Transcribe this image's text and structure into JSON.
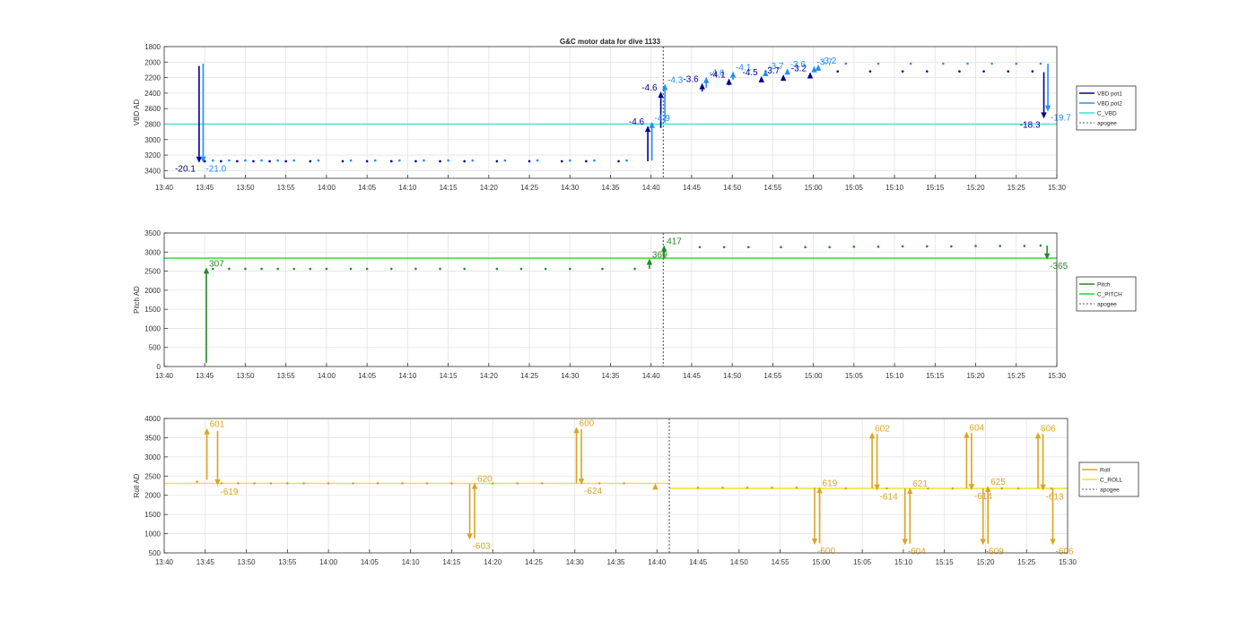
{
  "figure": {
    "title": "G&C motor data for dive 1133"
  },
  "chart_data": [
    {
      "type": "scatter",
      "ylabel": "VBD AD",
      "xlim": [
        "13:40",
        "15:30"
      ],
      "ylim": [
        1800,
        3500
      ],
      "y_reversed": true,
      "grid": true,
      "legend_placement": "right",
      "xticks": [
        "13:40",
        "13:45",
        "13:50",
        "13:55",
        "14:00",
        "14:05",
        "14:10",
        "14:15",
        "14:20",
        "14:25",
        "14:30",
        "14:35",
        "14:40",
        "14:45",
        "14:50",
        "14:55",
        "15:00",
        "15:05",
        "15:10",
        "15:15",
        "15:20",
        "15:25",
        "15:30"
      ],
      "yticks": [
        1800,
        2000,
        2200,
        2400,
        2600,
        2800,
        3000,
        3200,
        3400
      ],
      "legend": [
        {
          "name": "VBD pot1",
          "color": "#00008b"
        },
        {
          "name": "VBD pot2",
          "color": "#1e90ff"
        },
        {
          "name": "C_VBD",
          "color": "#40e0d0"
        },
        {
          "name": "apogee",
          "color": "#555555"
        }
      ],
      "apogee_x": "14:41.5",
      "reference": {
        "name": "C_VBD",
        "y": 2800,
        "color": "#40e0d0"
      },
      "series": [
        {
          "name": "VBD pot1",
          "color": "#00008b",
          "x": [
            "13:45",
            "13:47",
            "13:49",
            "13:51",
            "13:53",
            "13:55",
            "13:58",
            "14:02",
            "14:05",
            "14:08",
            "14:11",
            "14:14",
            "14:17",
            "14:21",
            "14:25",
            "14:29",
            "14:32",
            "14:36",
            "15:03",
            "15:07",
            "15:11",
            "15:14",
            "15:18",
            "15:21",
            "15:24",
            "15:27"
          ],
          "y": [
            3280,
            3280,
            3280,
            3280,
            3280,
            3280,
            3280,
            3280,
            3280,
            3280,
            3280,
            3280,
            3280,
            3280,
            3280,
            3280,
            3280,
            3280,
            2120,
            2120,
            2120,
            2120,
            2120,
            2120,
            2120,
            2120
          ]
        },
        {
          "name": "VBD pot2",
          "color": "#1e90ff",
          "x": [
            "13:46",
            "13:48",
            "13:50",
            "13:52",
            "13:54",
            "13:56",
            "13:59",
            "14:03",
            "14:06",
            "14:09",
            "14:12",
            "14:15",
            "14:18",
            "14:22",
            "14:26",
            "14:30",
            "14:33",
            "14:37",
            "15:04",
            "15:08",
            "15:12",
            "15:16",
            "15:19",
            "15:22",
            "15:25",
            "15:28"
          ],
          "y": [
            3270,
            3270,
            3270,
            3270,
            3270,
            3270,
            3270,
            3270,
            3270,
            3270,
            3270,
            3270,
            3270,
            3270,
            3270,
            3270,
            3270,
            3270,
            2020,
            2020,
            2020,
            2020,
            2020,
            2020,
            2020,
            2020
          ]
        }
      ],
      "arrows": [
        {
          "x": "13:44.3",
          "y0": 2050,
          "y1": 3300,
          "color": "#00008b",
          "label": "-20.1",
          "label_side": "left"
        },
        {
          "x": "13:44.8",
          "y0": 2020,
          "y1": 3300,
          "color": "#1e90ff",
          "label": "-21.0",
          "label_side": "right"
        },
        {
          "x": "14:39.6",
          "y0": 3280,
          "y1": 2820,
          "color": "#00008b",
          "label": "-4.6",
          "label_side": "left"
        },
        {
          "x": "14:40.1",
          "y0": 3270,
          "y1": 2770,
          "color": "#1e90ff",
          "label": "-4.9",
          "label_side": "right"
        },
        {
          "x": "14:41.2",
          "y0": 2850,
          "y1": 2380,
          "color": "#00008b",
          "label": "-4.6",
          "label_side": "left"
        },
        {
          "x": "14:41.7",
          "y0": 2780,
          "y1": 2280,
          "color": "#1e90ff",
          "label": "-4.3",
          "label_side": "right"
        },
        {
          "x": "14:46.3",
          "y0": 2380,
          "y1": 2270,
          "color": "#00008b",
          "label": "-3.6",
          "label_side": "left"
        },
        {
          "x": "14:46.8",
          "y0": 2330,
          "y1": 2190,
          "color": "#1e90ff",
          "label": "-4.6",
          "label_side": "right"
        },
        {
          "x": "14:49.6",
          "y0": 2300,
          "y1": 2210,
          "color": "#00008b",
          "label": "-4.1",
          "label_side": "left"
        },
        {
          "x": "14:50.1",
          "y0": 2230,
          "y1": 2120,
          "color": "#1e90ff",
          "label": "-4.1",
          "label_side": "right"
        },
        {
          "x": "14:53.6",
          "y0": 2250,
          "y1": 2180,
          "color": "#00008b",
          "label": "-4.5",
          "label_side": "left"
        },
        {
          "x": "14:54.1",
          "y0": 2180,
          "y1": 2100,
          "color": "#1e90ff",
          "label": "-3.7",
          "label_side": "right"
        },
        {
          "x": "14:56.3",
          "y0": 2220,
          "y1": 2160,
          "color": "#00008b",
          "label": "-3.7",
          "label_side": "left"
        },
        {
          "x": "14:56.8",
          "y0": 2130,
          "y1": 2080,
          "color": "#1e90ff",
          "label": "-3.6",
          "label_side": "right"
        },
        {
          "x": "14:59.6",
          "y0": 2180,
          "y1": 2130,
          "color": "#00008b",
          "label": "-3.2",
          "label_side": "left"
        },
        {
          "x": "15:00.1",
          "y0": 2110,
          "y1": 2050,
          "color": "#1e90ff",
          "label": "-3.7",
          "label_side": "right"
        },
        {
          "x": "15:00.6",
          "y0": 2110,
          "y1": 2030,
          "color": "#1e90ff",
          "label": "-3.2",
          "label_side": "right"
        },
        {
          "x": "15:28.4",
          "y0": 2130,
          "y1": 2730,
          "color": "#00008b",
          "label": "-18.3",
          "label_side": "left"
        },
        {
          "x": "15:28.9",
          "y0": 2020,
          "y1": 2640,
          "color": "#1e90ff",
          "label": "-19.7",
          "label_side": "right"
        }
      ]
    },
    {
      "type": "scatter",
      "ylabel": "Pitch AD",
      "xlim": [
        "13:40",
        "15:30"
      ],
      "ylim": [
        0,
        3500
      ],
      "grid": true,
      "legend_placement": "right",
      "xticks": [
        "13:40",
        "13:45",
        "13:50",
        "13:55",
        "14:00",
        "14:05",
        "14:10",
        "14:15",
        "14:20",
        "14:25",
        "14:30",
        "14:35",
        "14:40",
        "14:45",
        "14:50",
        "14:55",
        "15:00",
        "15:05",
        "15:10",
        "15:15",
        "15:20",
        "15:25",
        "15:30"
      ],
      "yticks": [
        0,
        500,
        1000,
        1500,
        2000,
        2500,
        3000,
        3500
      ],
      "legend": [
        {
          "name": "Pitch",
          "color": "#228b22"
        },
        {
          "name": "C_PITCH",
          "color": "#32cd32"
        },
        {
          "name": "apogee",
          "color": "#555555"
        }
      ],
      "apogee_x": "14:41.5",
      "reference": {
        "name": "C_PITCH",
        "y": 2840,
        "color": "#32cd32"
      },
      "series": [
        {
          "name": "Pitch",
          "color": "#228b22",
          "x": [
            "13:46",
            "13:48",
            "13:50",
            "13:52",
            "13:54",
            "13:56",
            "13:58",
            "14:00",
            "14:03",
            "14:05",
            "14:08",
            "14:11",
            "14:14",
            "14:17",
            "14:21",
            "14:24",
            "14:27",
            "14:30",
            "14:34",
            "14:38",
            "14:46",
            "14:49",
            "14:52",
            "14:56",
            "14:59",
            "15:02",
            "15:05",
            "15:08",
            "15:11",
            "15:14",
            "15:17",
            "15:20",
            "15:23",
            "15:26",
            "15:28"
          ],
          "y": [
            2560,
            2560,
            2560,
            2560,
            2560,
            2560,
            2560,
            2560,
            2560,
            2560,
            2560,
            2560,
            2560,
            2560,
            2560,
            2560,
            2560,
            2560,
            2560,
            2560,
            3130,
            3130,
            3130,
            3130,
            3130,
            3130,
            3140,
            3140,
            3150,
            3150,
            3150,
            3160,
            3160,
            3160,
            3170
          ]
        }
      ],
      "arrows": [
        {
          "x": "13:45.2",
          "y0": 100,
          "y1": 2600,
          "color": "#228b22",
          "label": "307",
          "label_side": "right"
        },
        {
          "x": "14:39.8",
          "y0": 2560,
          "y1": 2830,
          "color": "#228b22",
          "label": "369",
          "label_side": "right"
        },
        {
          "x": "14:41.6",
          "y0": 2840,
          "y1": 3180,
          "color": "#228b22",
          "label": "417",
          "label_side": "right"
        },
        {
          "x": "15:28.8",
          "y0": 3170,
          "y1": 2800,
          "color": "#228b22",
          "label": "-365",
          "label_side": "right"
        }
      ]
    },
    {
      "type": "scatter",
      "ylabel": "Roll AD",
      "xlim": [
        "13:40",
        "15:30"
      ],
      "ylim": [
        500,
        4000
      ],
      "grid": true,
      "legend_placement": "right",
      "xticks": [
        "13:40",
        "13:45",
        "13:50",
        "13:55",
        "14:00",
        "14:05",
        "14:10",
        "14:15",
        "14:20",
        "14:25",
        "14:30",
        "14:35",
        "14:40",
        "14:45",
        "14:50",
        "14:55",
        "15:00",
        "15:05",
        "15:10",
        "15:15",
        "15:20",
        "15:25",
        "15:30"
      ],
      "yticks": [
        500,
        1000,
        1500,
        2000,
        2500,
        3000,
        3500,
        4000
      ],
      "legend": [
        {
          "name": "Roll",
          "color": "#daa520"
        },
        {
          "name": "C_ROLL",
          "color": "#f0e130"
        },
        {
          "name": "apogee",
          "color": "#555555"
        }
      ],
      "apogee_x": "14:41.5",
      "reference_segments": [
        {
          "x0": "13:40",
          "x1": "14:41.5",
          "y": 2310,
          "color": "#f0e130"
        },
        {
          "x0": "14:41.5",
          "x1": "15:30",
          "y": 2180,
          "color": "#f0e130"
        }
      ],
      "series": [
        {
          "name": "Roll",
          "color": "#daa520",
          "x": [
            "13:44",
            "13:47",
            "13:49",
            "13:51",
            "13:53",
            "13:55",
            "13:57",
            "14:00",
            "14:03",
            "14:06",
            "14:09",
            "14:12",
            "14:15",
            "14:20",
            "14:23",
            "14:26",
            "14:33",
            "14:36",
            "14:45",
            "14:48",
            "14:51",
            "14:54",
            "14:57",
            "15:03",
            "15:08",
            "15:13",
            "15:16",
            "15:22",
            "15:24",
            "15:28"
          ],
          "y": [
            2350,
            2310,
            2310,
            2310,
            2310,
            2310,
            2310,
            2310,
            2310,
            2310,
            2310,
            2310,
            2310,
            2310,
            2310,
            2310,
            2310,
            2310,
            2200,
            2200,
            2200,
            2200,
            2200,
            2180,
            2180,
            2180,
            2180,
            2180,
            2180,
            2180
          ]
        }
      ],
      "arrows": [
        {
          "x": "13:45.2",
          "y0": 2400,
          "y1": 3750,
          "color": "#daa520",
          "label": "601",
          "label_side": "right"
        },
        {
          "x": "13:46.5",
          "y0": 3680,
          "y1": 2250,
          "color": "#daa520",
          "label": "-619",
          "label_side": "right"
        },
        {
          "x": "14:17.2",
          "y0": 2300,
          "y1": 840,
          "color": "#daa520",
          "label": "-603",
          "label_side": "right"
        },
        {
          "x": "14:17.8",
          "y0": 880,
          "y1": 2330,
          "color": "#daa520",
          "label": "620",
          "label_side": "right"
        },
        {
          "x": "14:30.2",
          "y0": 2310,
          "y1": 3780,
          "color": "#daa520",
          "label": "600",
          "label_side": "right"
        },
        {
          "x": "14:30.8",
          "y0": 3720,
          "y1": 2270,
          "color": "#daa520",
          "label": "-624",
          "label_side": "right"
        },
        {
          "x": "14:39.8",
          "y0": 2150,
          "y1": 2310,
          "color": "#daa520",
          "label": "",
          "label_side": "right"
        },
        {
          "x": "14:59.2",
          "y0": 2200,
          "y1": 710,
          "color": "#daa520",
          "label": "-600",
          "label_side": "right"
        },
        {
          "x": "14:59.8",
          "y0": 750,
          "y1": 2220,
          "color": "#daa520",
          "label": "619",
          "label_side": "right"
        },
        {
          "x": "15:06.2",
          "y0": 2180,
          "y1": 3640,
          "color": "#daa520",
          "label": "602",
          "label_side": "right"
        },
        {
          "x": "15:06.8",
          "y0": 3600,
          "y1": 2120,
          "color": "#daa520",
          "label": "-614",
          "label_side": "right"
        },
        {
          "x": "15:10.2",
          "y0": 2180,
          "y1": 700,
          "color": "#daa520",
          "label": "-604",
          "label_side": "right"
        },
        {
          "x": "15:10.8",
          "y0": 740,
          "y1": 2200,
          "color": "#daa520",
          "label": "621",
          "label_side": "right"
        },
        {
          "x": "15:17.7",
          "y0": 2180,
          "y1": 3660,
          "color": "#daa520",
          "label": "604",
          "label_side": "right"
        },
        {
          "x": "15:18.3",
          "y0": 3620,
          "y1": 2130,
          "color": "#daa520",
          "label": "-614",
          "label_side": "right"
        },
        {
          "x": "15:19.7",
          "y0": 2180,
          "y1": 700,
          "color": "#daa520",
          "label": "-609",
          "label_side": "right"
        },
        {
          "x": "15:20.3",
          "y0": 740,
          "y1": 2250,
          "color": "#daa520",
          "label": "625",
          "label_side": "right"
        },
        {
          "x": "15:26.4",
          "y0": 2180,
          "y1": 3640,
          "color": "#daa520",
          "label": "606",
          "label_side": "right"
        },
        {
          "x": "15:27.0",
          "y0": 3600,
          "y1": 2120,
          "color": "#daa520",
          "label": "-613",
          "label_side": "right"
        },
        {
          "x": "15:28.2",
          "y0": 2180,
          "y1": 700,
          "color": "#daa520",
          "label": "-606",
          "label_side": "right"
        }
      ]
    }
  ]
}
